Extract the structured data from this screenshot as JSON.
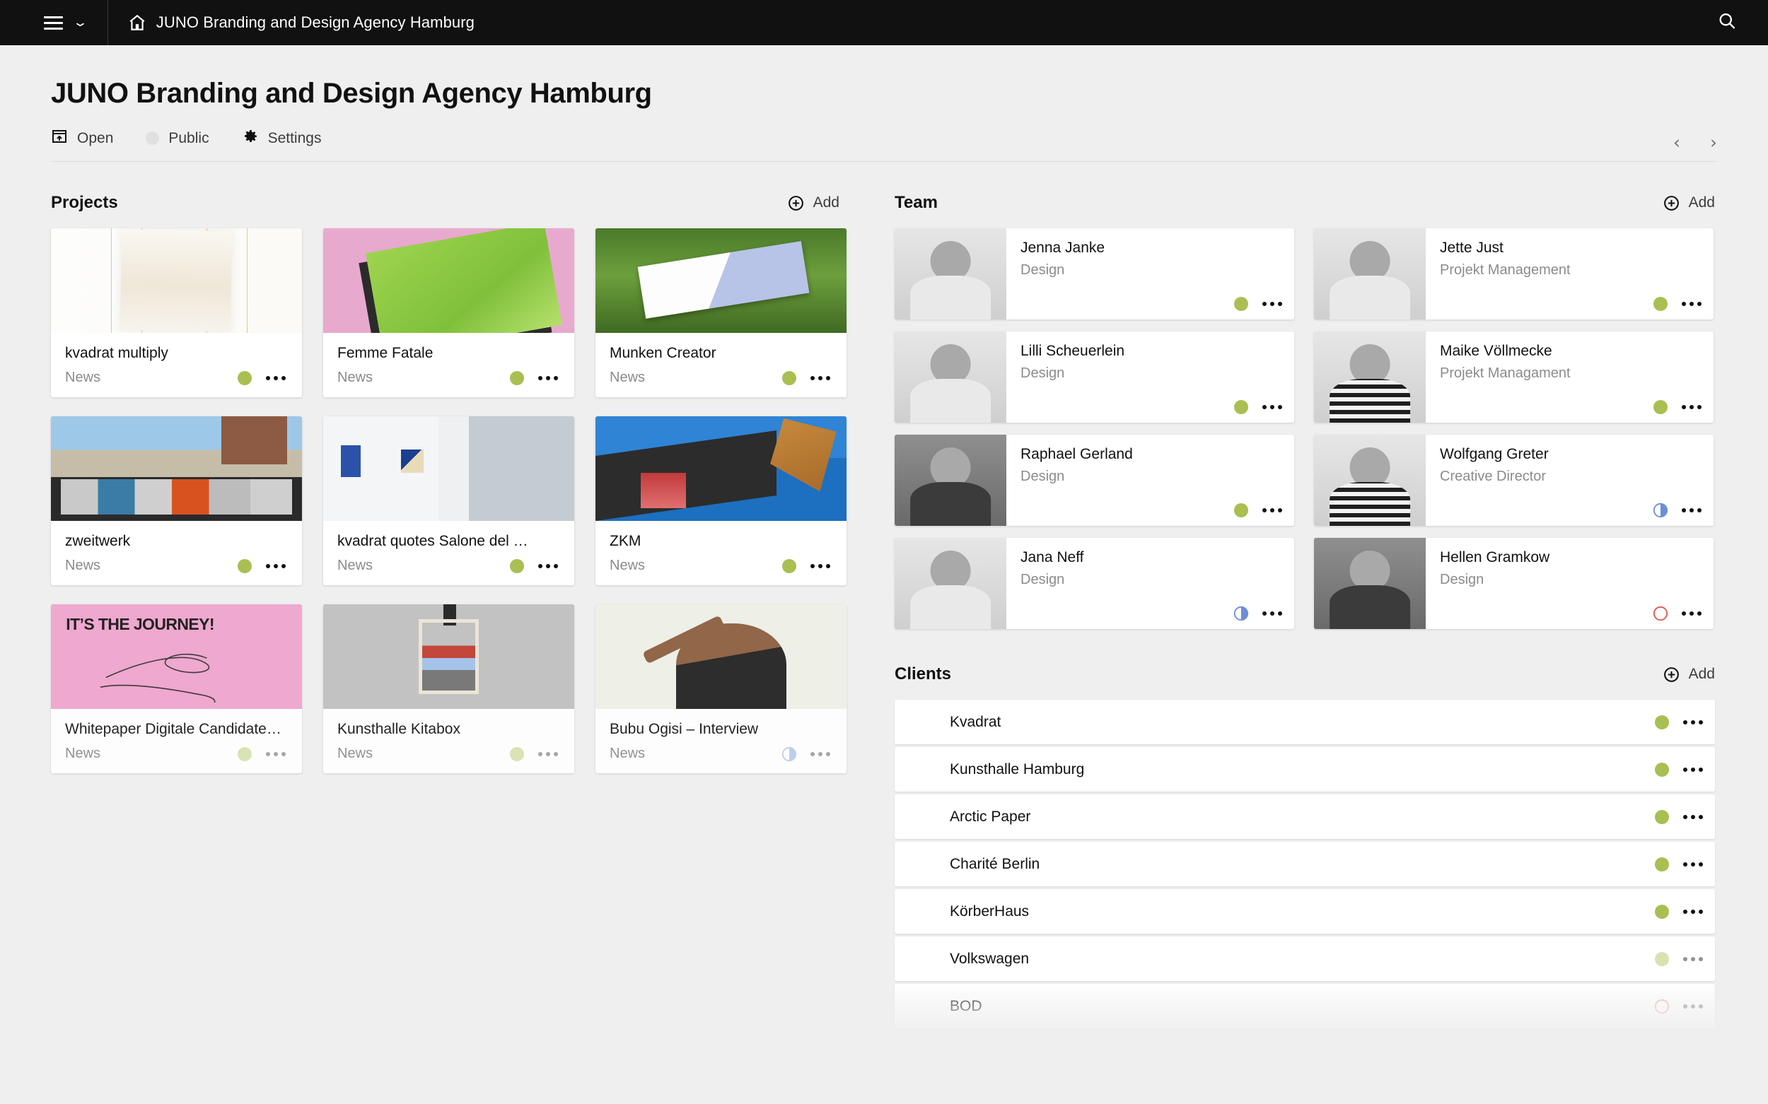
{
  "topbar": {
    "menu_icon": "hamburger-icon",
    "chevron_icon": "chevron-down-icon",
    "home_icon": "home-icon",
    "title": "JUNO Branding and Design Agency Hamburg",
    "search_icon": "search-icon"
  },
  "header": {
    "title": "JUNO Branding and Design Agency Hamburg",
    "meta": {
      "open_label": "Open",
      "open_icon": "open-board-icon",
      "public_label": "Public",
      "public_icon": "visibility-dot-icon",
      "settings_label": "Settings",
      "settings_icon": "gear-icon"
    },
    "nav": {
      "prev": "‹",
      "next": "›"
    }
  },
  "colors": {
    "accent_green": "#a9bf52",
    "accent_blue": "#6b8ed6",
    "accent_red": "#e05a4e",
    "page_bg": "#efefef",
    "topbar_bg": "#111111"
  },
  "projects": {
    "title": "Projects",
    "add_label": "Add",
    "add_icon": "plus-circle-icon",
    "items": [
      {
        "name": "kvadrat multiply",
        "tag": "News",
        "status": "green",
        "art": "t-kvadrat",
        "faded": false
      },
      {
        "name": "Femme Fatale",
        "tag": "News",
        "status": "green",
        "art": "t-femme",
        "faded": false
      },
      {
        "name": "Munken Creator",
        "tag": "News",
        "status": "green",
        "art": "t-munken",
        "faded": false
      },
      {
        "name": "zweitwerk",
        "tag": "News",
        "status": "green",
        "art": "t-zweit",
        "faded": false
      },
      {
        "name": "kvadrat quotes Salone del …",
        "tag": "News",
        "status": "green",
        "art": "t-salone",
        "faded": false
      },
      {
        "name": "ZKM",
        "tag": "News",
        "status": "green",
        "art": "t-zkm",
        "faded": false
      },
      {
        "name": "Whitepaper Digitale Candidate…",
        "tag": "News",
        "status": "green",
        "art": "t-journey",
        "faded": true
      },
      {
        "name": "Kunsthalle Kitabox",
        "tag": "News",
        "status": "green",
        "art": "t-kita",
        "faded": true
      },
      {
        "name": "Bubu Ogisi – Interview",
        "tag": "News",
        "status": "blue-half",
        "art": "t-bubu",
        "faded": true
      }
    ]
  },
  "team": {
    "title": "Team",
    "add_label": "Add",
    "add_icon": "plus-circle-icon",
    "members": [
      {
        "name": "Jenna Janke",
        "role": "Design",
        "status": "green",
        "photo": "light"
      },
      {
        "name": "Jette Just",
        "role": "Projekt Management",
        "status": "green",
        "photo": "light"
      },
      {
        "name": "Lilli Scheuerlein",
        "role": "Design",
        "status": "green",
        "photo": "light"
      },
      {
        "name": "Maike Völlmecke",
        "role": "Projekt Managament",
        "status": "green",
        "photo": "stripe"
      },
      {
        "name": "Raphael Gerland",
        "role": "Design",
        "status": "green",
        "photo": "dark"
      },
      {
        "name": "Wolfgang Greter",
        "role": "Creative Director",
        "status": "blue-half",
        "photo": "stripe"
      },
      {
        "name": "Jana Neff",
        "role": "Design",
        "status": "blue-half",
        "photo": "light"
      },
      {
        "name": "Hellen Gramkow",
        "role": "Design",
        "status": "red-ring",
        "photo": "dark"
      }
    ]
  },
  "clients": {
    "title": "Clients",
    "add_label": "Add",
    "add_icon": "plus-circle-icon",
    "items": [
      {
        "name": "Kvadrat",
        "status": "green",
        "faded": false
      },
      {
        "name": "Kunsthalle Hamburg",
        "status": "green",
        "faded": false
      },
      {
        "name": "Arctic Paper",
        "status": "green",
        "faded": false
      },
      {
        "name": "Charité Berlin",
        "status": "green",
        "faded": false
      },
      {
        "name": "KörberHaus",
        "status": "green",
        "faded": false
      },
      {
        "name": "Volkswagen",
        "status": "green",
        "faded": true
      },
      {
        "name": "BOD",
        "status": "red-ring",
        "faded": true
      }
    ]
  }
}
